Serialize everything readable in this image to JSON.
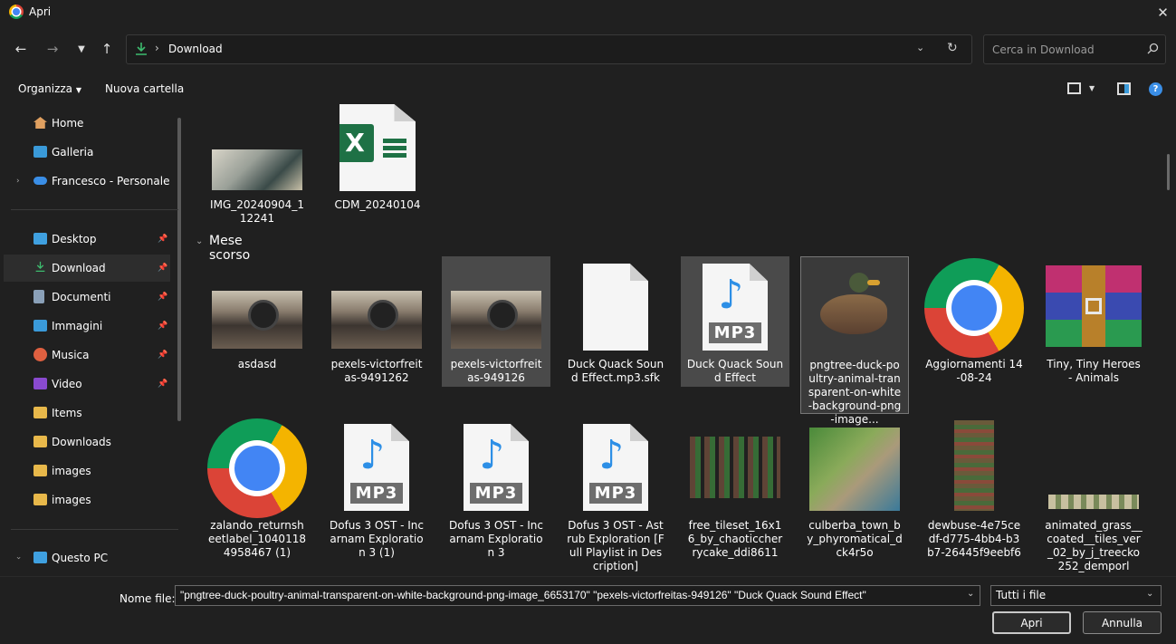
{
  "window": {
    "title": "Apri"
  },
  "address": {
    "folder": "Download"
  },
  "search": {
    "placeholder": "Cerca in Download"
  },
  "toolbar": {
    "organize": "Organizza",
    "new_folder": "Nuova cartella"
  },
  "sidebar": {
    "items": [
      {
        "label": "Home",
        "icon": "home-icon",
        "color": "#e0a060"
      },
      {
        "label": "Galleria",
        "icon": "gallery-icon",
        "color": "#3a9ad9"
      },
      {
        "label": "Francesco - Personale",
        "icon": "cloud-icon",
        "color": "#3a8ee6"
      },
      {
        "label": "Desktop",
        "icon": "desktop-icon",
        "color": "#3fa0e0"
      },
      {
        "label": "Download",
        "icon": "download-icon",
        "color": "#3dbb6e"
      },
      {
        "label": "Documenti",
        "icon": "documents-icon",
        "color": "#8aa0b8"
      },
      {
        "label": "Immagini",
        "icon": "pictures-icon",
        "color": "#3a9ad9"
      },
      {
        "label": "Musica",
        "icon": "music-icon",
        "color": "#e06040"
      },
      {
        "label": "Video",
        "icon": "video-icon",
        "color": "#8a4ad0"
      },
      {
        "label": "Items",
        "icon": "folder-icon",
        "color": "#e8b84a"
      },
      {
        "label": "Downloads",
        "icon": "folder-icon",
        "color": "#e8b84a"
      },
      {
        "label": "images",
        "icon": "folder-icon",
        "color": "#e8b84a"
      },
      {
        "label": "images",
        "icon": "folder-icon",
        "color": "#e8b84a"
      },
      {
        "label": "Questo PC",
        "icon": "pc-icon",
        "color": "#3fa0e0"
      }
    ]
  },
  "files": {
    "top": [
      "IMG_20240904_112241",
      "CDM_20240104"
    ],
    "group": "Mese scorso",
    "row1": [
      "asdasd",
      "pexels-victorfreitas-9491262",
      "pexels-victorfreitas-949126",
      "Duck Quack Sound Effect.mp3.sfk",
      "Duck Quack Sound Effect",
      "pngtree-duck-poultry-animal-transparent-on-white-background-png-image...",
      "Aggiornamenti 14-08-24",
      "Tiny, Tiny Heroes - Animals"
    ],
    "row2": [
      "zalando_returnsheetlabel_10401184958467 (1)",
      "Dofus 3 OST - Incarnam Exploration 3 (1)",
      "Dofus 3 OST - Incarnam Exploration 3",
      "Dofus 3 OST - Astrub Exploration [Full Playlist in Description]",
      "free_tileset_16x16_by_chaoticcherrycake_ddi8611",
      "culberba_town_by_phyromatical_dck4r5o",
      "dewbuse-4e75cedf-d775-4bb4-b3b7-26445f9eebf6",
      "animated_grass__coated__tiles_ver_02_by_j_treecko252_demporl"
    ],
    "excel_letter": "X",
    "mp3_label": "MP3"
  },
  "footer": {
    "filename_label": "Nome file:",
    "filename_value": "\"pngtree-duck-poultry-animal-transparent-on-white-background-png-image_6653170\" \"pexels-victorfreitas-949126\" \"Duck Quack Sound Effect\"",
    "filter": "Tutti i file",
    "open": "Apri",
    "cancel": "Annulla"
  }
}
